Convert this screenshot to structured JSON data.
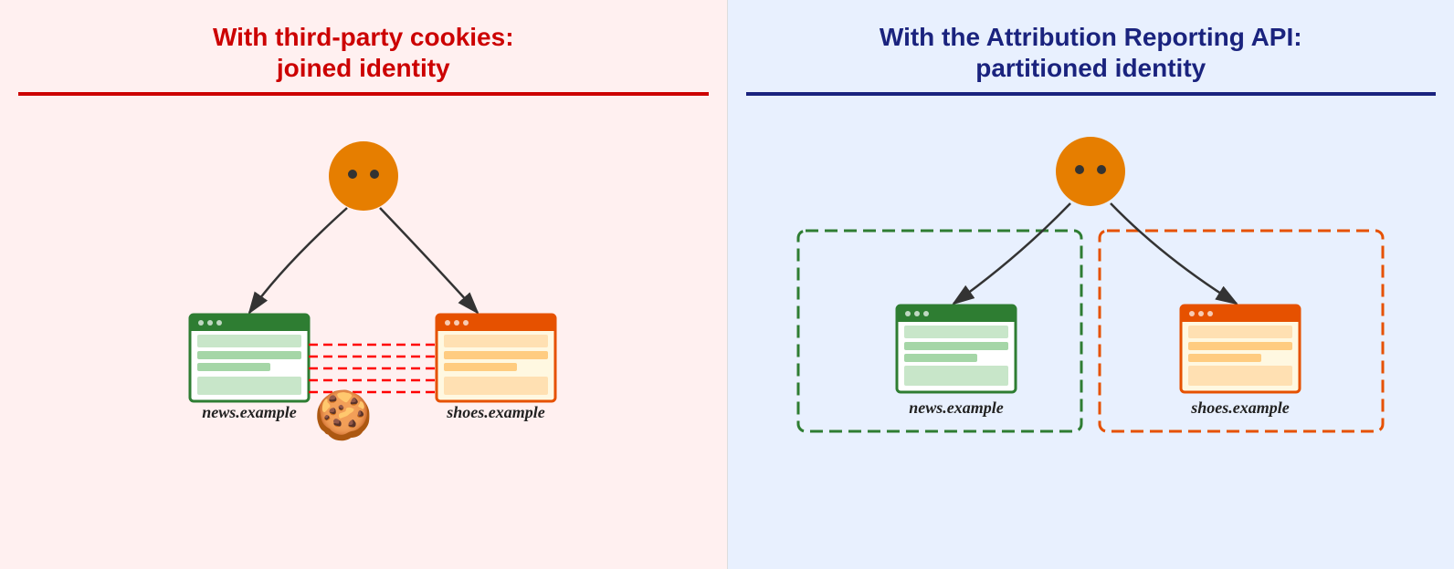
{
  "left_panel": {
    "title_line1": "With third-party cookies:",
    "title_line2": "joined identity",
    "bg_color": "#fff0f0",
    "title_color": "#cc0000",
    "divider_color": "#cc0000",
    "site1_label": "news.example",
    "site2_label": "shoes.example"
  },
  "right_panel": {
    "title_line1": "With the Attribution Reporting API:",
    "title_line2": "partitioned identity",
    "bg_color": "#e8f0fe",
    "title_color": "#1a237e",
    "divider_color": "#1a237e",
    "site1_label": "news.example",
    "site2_label": "shoes.example"
  }
}
